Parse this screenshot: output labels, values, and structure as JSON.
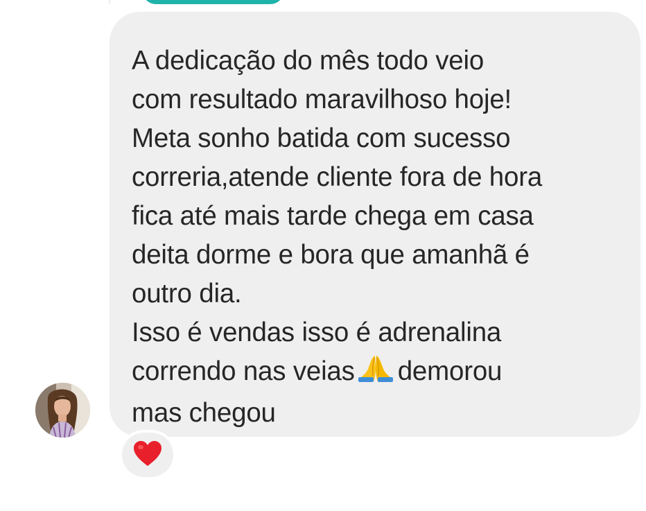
{
  "message": {
    "lines_part1": [
      "A dedicação do mês todo veio",
      "com resultado  maravilhoso hoje!",
      "Meta sonho batida com sucesso",
      "correria,atende cliente fora de hora",
      "fica até mais tarde chega em casa",
      "deita dorme e bora que amanhã é",
      "outro dia.",
      "Isso é vendas isso é adrenalina"
    ],
    "line9_before_emoji": "correndo nas veias",
    "line9_after_emoji": "demorou",
    "line10": "mas chegou",
    "emoji": "folded-hands-icon"
  },
  "reaction": {
    "emoji": "heart-icon",
    "color": "#e8202c"
  },
  "colors": {
    "bubble": "#efefef",
    "text": "#262626",
    "previous_bubble": "#1fb3ab"
  }
}
